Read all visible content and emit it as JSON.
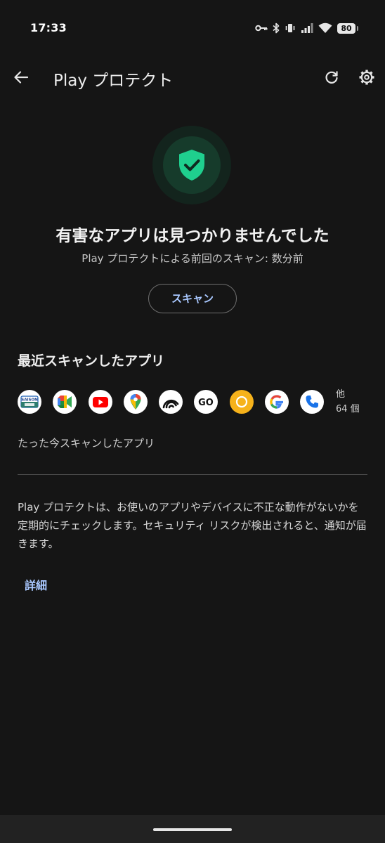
{
  "status_bar": {
    "time": "17:33",
    "battery": "80"
  },
  "app_bar": {
    "title": "Play プロテクト"
  },
  "status": {
    "headline": "有害なアプリは見つかりませんでした",
    "last_scan": "Play プロテクトによる前回のスキャン: 数分前"
  },
  "scan_button": "スキャン",
  "recent": {
    "title": "最近スキャンしたアプリ",
    "apps": [
      {
        "name": "saison-card-app-icon",
        "label": "SAISON"
      },
      {
        "name": "google-meet-app-icon"
      },
      {
        "name": "youtube-app-icon"
      },
      {
        "name": "google-maps-app-icon"
      },
      {
        "name": "rainbow-app-icon"
      },
      {
        "name": "go-app-icon",
        "label": "GO"
      },
      {
        "name": "yellow-ring-app-icon"
      },
      {
        "name": "google-app-icon"
      },
      {
        "name": "phone-app-icon"
      }
    ],
    "more_label": "他",
    "more_count": "64 個",
    "note": "たった今スキャンしたアプリ"
  },
  "description": "Play プロテクトは、お使いのアプリやデバイスに不正な動作がないかを定期的にチェックします。セキュリティ リスクが検出されると、通知が届きます。",
  "details_link": "詳細",
  "colors": {
    "background": "#151515",
    "accent": "#a9c8ff",
    "shield_green": "#1fcf8e"
  }
}
